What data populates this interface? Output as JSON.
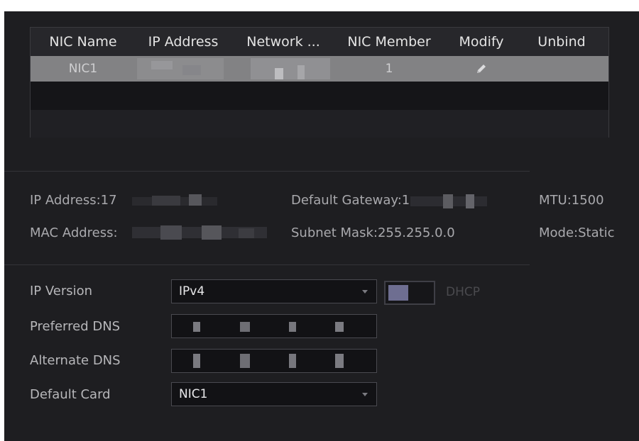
{
  "nic_table": {
    "headers": [
      "NIC Name",
      "IP Address",
      "Network ...",
      "NIC Member",
      "Modify",
      "Unbind"
    ],
    "rows": [
      {
        "nic_name": "NIC1",
        "nic_member": "1",
        "modify_icon": "pencil-icon"
      }
    ]
  },
  "network_info": {
    "ip_address_label": "IP Address:17",
    "mac_address_label": "MAC Address:",
    "default_gateway_label": "Default Gateway:1",
    "subnet_mask_label": "Subnet Mask:",
    "subnet_mask_value": "255.255.0.0",
    "mtu_label": "MTU:",
    "mtu_value": "1500",
    "mode_label": "Mode:",
    "mode_value": "Static"
  },
  "form": {
    "ip_version": {
      "label": "IP Version",
      "value": "IPv4"
    },
    "dhcp_label": "DHCP",
    "dhcp_enabled": false,
    "preferred_dns": {
      "label": "Preferred DNS"
    },
    "alternate_dns": {
      "label": "Alternate DNS"
    },
    "default_card": {
      "label": "Default Card",
      "value": "NIC1"
    }
  },
  "colors": {
    "panel_bg": "#1e1e21",
    "selected_row_bg": "#828284",
    "toggle_knob": "#6e6e91"
  }
}
